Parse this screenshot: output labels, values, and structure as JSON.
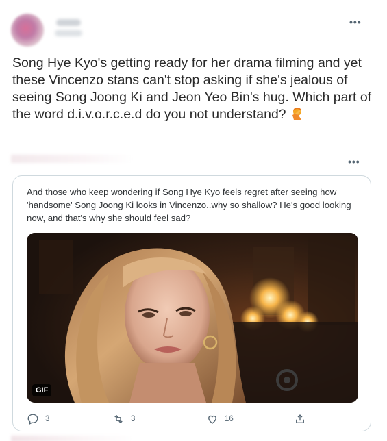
{
  "tweet1": {
    "more_icon": "more-options-icon",
    "text": "Song Hye Kyo's getting ready for her drama filming and yet these Vincenzo stans can't stop asking if she's jealous of seeing Song Joong Ki and Jeon Yeo Bin's hug. Which part of the word d.i.v.o.r.c.e.d do you not understand?",
    "emoji": "facepalm-emoji"
  },
  "tweet2": {
    "more_icon": "more-options-icon",
    "quote": "And those who keep wondering if Song Hye Kyo feels regret after seeing how 'handsome' Song Joong Ki looks in Vincenzo..why so shallow? He's good looking now, and that's why she should feel sad?",
    "media_badge": "GIF",
    "actions": {
      "reply_count": "3",
      "retweet_count": "3",
      "like_count": "16"
    }
  },
  "colors": {
    "text": "#2a2a2a",
    "secondary": "#536471",
    "border": "#cfd9de"
  }
}
